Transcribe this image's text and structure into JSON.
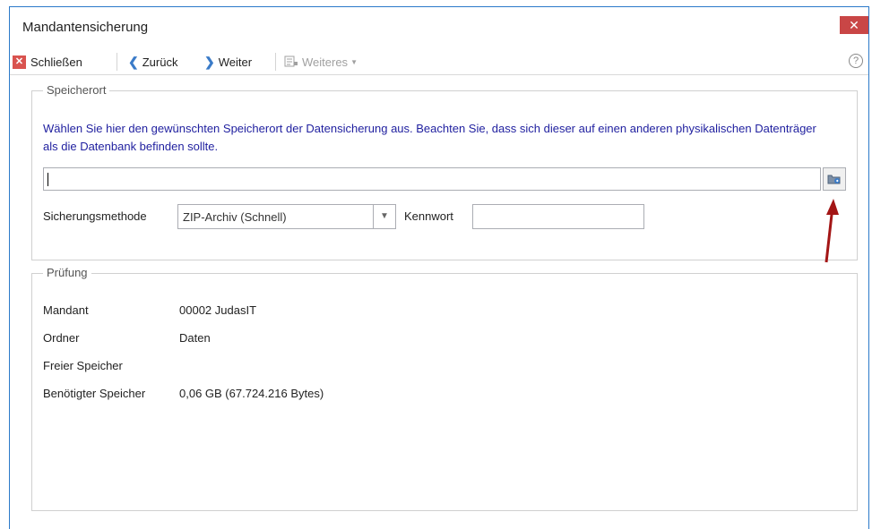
{
  "window": {
    "title": "Mandantensicherung",
    "close_glyph": "✕"
  },
  "toolbar": {
    "close_label": "Schließen",
    "back_label": "Zurück",
    "next_label": "Weiter",
    "more_label": "Weiteres",
    "help_glyph": "?"
  },
  "storage": {
    "legend": "Speicherort",
    "info": "Wählen Sie hier den gewünschten Speicherort der Datensicherung aus. Beachten Sie, dass sich dieser auf einen anderen physikalischen Datenträger als die Datenbank befinden sollte.",
    "path_value": "",
    "method_label": "Sicherungsmethode",
    "method_value": "ZIP-Archiv (Schnell)",
    "password_label": "Kennwort",
    "password_value": ""
  },
  "check": {
    "legend": "Prüfung",
    "rows": [
      {
        "label": "Mandant",
        "value": "00002  JudasIT"
      },
      {
        "label": "Ordner",
        "value": "Daten"
      },
      {
        "label": "Freier Speicher",
        "value": ""
      },
      {
        "label": "Benötigter Speicher",
        "value": "0,06 GB (67.724.216 Bytes)"
      }
    ]
  },
  "colors": {
    "accent": "#2b79c9",
    "close": "#c94646",
    "info_text": "#1f1f9f",
    "annotation_arrow": "#a31515"
  }
}
